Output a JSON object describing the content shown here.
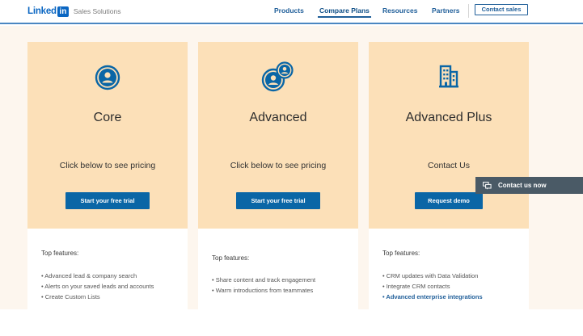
{
  "header": {
    "logo_word": "Linked",
    "logo_in": "in",
    "logo_sub": "Sales Solutions",
    "nav": [
      "Products",
      "Compare Plans",
      "Resources",
      "Partners"
    ],
    "active_nav": "Compare Plans",
    "contact_sales": "Contact sales"
  },
  "plans": [
    {
      "name": "Core",
      "icon": "single-person-icon",
      "pricing": "Click below to see pricing",
      "button": "Start your free trial",
      "features_title": "Top features:",
      "features": [
        "• Advanced lead & company search",
        "• Alerts on your saved leads and accounts",
        "• Create Custom Lists"
      ]
    },
    {
      "name": "Advanced",
      "icon": "two-people-icon",
      "pricing": "Click below to see pricing",
      "button": "Start your free trial",
      "features_title": "Top features:",
      "features": [
        "• Share content and track engagement",
        "• Warm introductions from teammates"
      ]
    },
    {
      "name": "Advanced Plus",
      "icon": "building-icon",
      "pricing": "Contact Us",
      "button": "Request demo",
      "features_title": "Top features:",
      "features": [
        "• CRM updates with Data Validation",
        "• Integrate CRM contacts"
      ],
      "feature_link": "• Advanced enterprise integrations"
    }
  ],
  "contact_now": "Contact us now",
  "colors": {
    "brand_blue": "#0a66c2",
    "button_blue": "#0a66a6",
    "card_peach": "#fce0b8",
    "page_bg": "#fdf6ee"
  }
}
